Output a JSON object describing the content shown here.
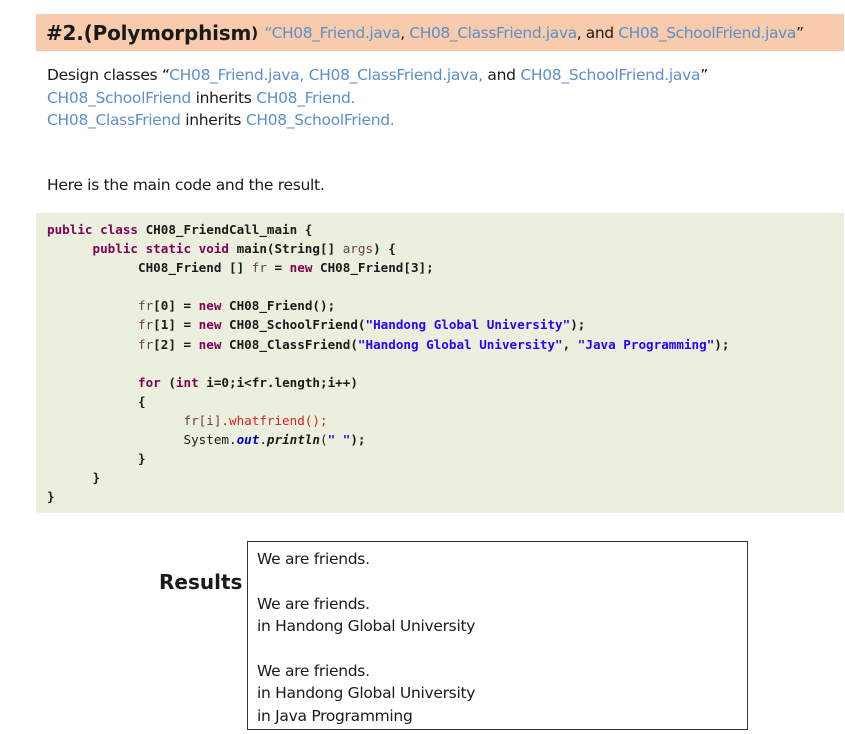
{
  "title": {
    "main": "#2.(Polymorphism",
    "paren": ")",
    "file1": "“CH08_Friend.java",
    "sep1": ",",
    "file2": "CH08_ClassFriend.java",
    "and": ", and",
    "file3": "CH08_SchoolFriend.java",
    "close": "”"
  },
  "description": {
    "line1_prefix": "Design classes “",
    "line1_file1": "CH08_Friend.java,",
    "line1_file2": "CH08_ClassFriend.java,",
    "line1_and": "and",
    "line1_file3": "CH08_SchoolFriend.java",
    "line1_close": "”",
    "line2_child": "CH08_SchoolFriend",
    "line2_verb": "inherits",
    "line2_parent": "CH08_Friend.",
    "line3_child": "CH08_ClassFriend",
    "line3_verb": "inherits",
    "line3_parent": "CH08_SchoolFriend."
  },
  "intro_text": "Here is the main code and the result.",
  "code": {
    "l1_kw": "public class",
    "l1_rest": " CH08_FriendCall_main {",
    "l2_kw": "public static void",
    "l2_rest": " main(String[] ",
    "l2_var": "args",
    "l2_end": ") {",
    "l3_a": "CH08_Friend [] ",
    "l3_var": "fr",
    "l3_b": " = ",
    "l3_kw": "new",
    "l3_c": " CH08_Friend[3];",
    "l5_var": "fr",
    "l5_a": "[0] = ",
    "l5_kw": "new",
    "l5_b": " CH08_Friend();",
    "l6_var": "fr",
    "l6_a": "[1] = ",
    "l6_kw": "new",
    "l6_b": " CH08_SchoolFriend(",
    "l6_str": "\"Handong Global University\"",
    "l6_c": ");",
    "l7_var": "fr",
    "l7_a": "[2] = ",
    "l7_kw": "new",
    "l7_b": " CH08_ClassFriend(",
    "l7_str1": "\"Handong Global University\"",
    "l7_c": ", ",
    "l7_str2": "\"Java Programming\"",
    "l7_d": ");",
    "l9_kw": "for",
    "l9_a": " (",
    "l9_kw2": "int",
    "l9_b": " i=0;i<fr.length;i++)",
    "l10": "{",
    "l11_var": "fr[i].",
    "l11_red": "whatfriend();",
    "l12_a": "System.",
    "l12_st": "out",
    "l12_b": ".",
    "l12_it": "println",
    "l12_c": "(",
    "l12_str": "\" \"",
    "l12_d": ");",
    "l13": "}",
    "l14": "}",
    "l15": "}"
  },
  "results": {
    "label": "Results",
    "lines": [
      "We are friends.",
      "We are friends.",
      "in Handong Global University",
      "We are friends.",
      "in Handong Global University",
      "in Java Programming"
    ]
  }
}
